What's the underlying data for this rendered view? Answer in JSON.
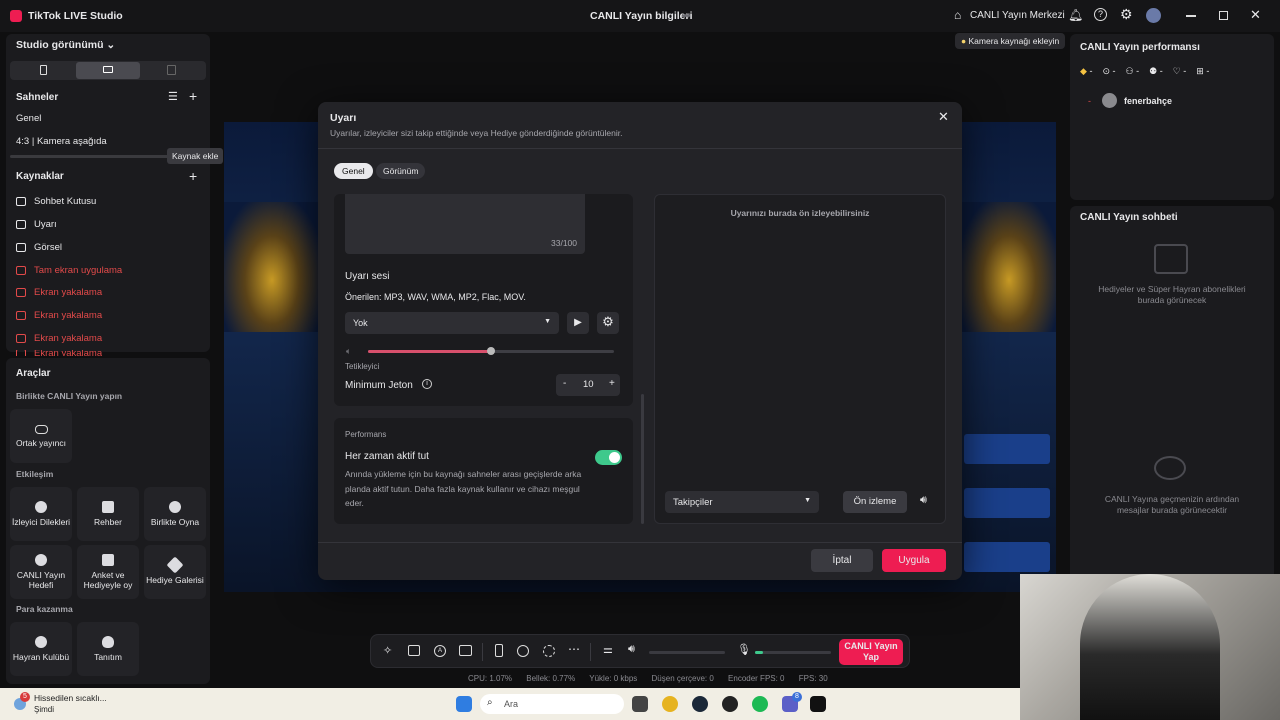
{
  "app": {
    "title": "TikTok LIVE Studio",
    "center_title": "CANLI Yayın bilgileri",
    "live_center": "CANLI Yayın Merkezi",
    "camera_hint": "Kamera kaynağı ekleyin"
  },
  "left": {
    "studio_view": "Studio görünümü",
    "scenes_title": "Sahneler",
    "scenes": [
      "Genel",
      "4:3 | Kamera aşağıda"
    ],
    "tooltip": "Kaynak ekle",
    "sources_title": "Kaynaklar",
    "sources": [
      {
        "label": "Sohbet Kutusu",
        "error": false
      },
      {
        "label": "Uyarı",
        "error": false
      },
      {
        "label": "Görsel",
        "error": false
      },
      {
        "label": "Tam ekran uygulama",
        "error": true
      },
      {
        "label": "Ekran yakalama",
        "error": true
      },
      {
        "label": "Ekran yakalama",
        "error": true
      },
      {
        "label": "Ekran yakalama",
        "error": true
      },
      {
        "label": "Ekran yakalama",
        "error": true
      }
    ],
    "tools_title": "Araçlar",
    "collab_title": "Birlikte CANLI Yayın yapın",
    "cohost": "Ortak yayıncı",
    "interaction_title": "Etkileşim",
    "interaction": [
      "İzleyici Dilekleri",
      "Rehber",
      "Birlikte Oyna",
      "CANLI Yayın Hedefi",
      "Anket ve Hediyeyle oy",
      "Hediye Galerisi"
    ],
    "earn_title": "Para kazanma",
    "earn": [
      "Hayran Kulübü",
      "Tanıtım"
    ]
  },
  "right": {
    "perf_title": "CANLI Yayın performansı",
    "metric_dash": "-",
    "top_user": "fenerbahçe",
    "rank_dash": "-",
    "chat_title": "CANLI Yayın sohbeti",
    "gifts_empty": "Hediyeler ve Süper Hayran abonelikleri burada görünecek",
    "chat_empty": "CANLI Yayına geçmenizin ardından mesajlar burada görünecektir"
  },
  "modal": {
    "title": "Uyarı",
    "subtitle": "Uyarılar, izleyiciler sizi takip ettiğinde veya Hediye gönderdiğinde görüntülenir.",
    "tabs": [
      "Genel",
      "Görünüm"
    ],
    "char_count": "33/100",
    "sound_title": "Uyarı sesi",
    "sound_hint": "Önerilen: MP3, WAV, WMA, MP2, Flac, MOV.",
    "sound_value": "Yok",
    "volume": 0.5,
    "trigger_label": "Tetikleyici",
    "min_coins_label": "Minimum Jeton",
    "min_coins_value": "10",
    "minus": "-",
    "plus": "+",
    "perf_label": "Performans",
    "always_active": "Her zaman aktif tut",
    "always_active_on": true,
    "always_active_desc": "Anında yükleme için bu kaynağı sahneler arası geçişlerde arka planda aktif tutun. Daha fazla kaynak kullanır ve cihazı meşgul eder.",
    "preview_hint": "Uyarınızı burada ön izleyebilirsiniz",
    "preview_select": "Takipçiler",
    "preview_button": "Ön izleme",
    "cancel": "İptal",
    "apply": "Uygula"
  },
  "bottom": {
    "go_live": "CANLI Yayın Yap",
    "stats": [
      "CPU: 1.07%",
      "Bellek: 0.77%",
      "Yükle: 0 kbps",
      "Düşen çerçeve: 0",
      "Encoder FPS: 0",
      "FPS: 30"
    ],
    "mic_level": 0.1
  },
  "taskbar": {
    "weather": "Hissedilen sıcaklı...",
    "weather_sub": "Şimdi",
    "weather_badge": "5",
    "search": "Ara",
    "teams_badge": "8"
  },
  "colors": {
    "accent": "#ee1d52",
    "toggle": "#3ec98c",
    "slider": "#d8506c"
  }
}
